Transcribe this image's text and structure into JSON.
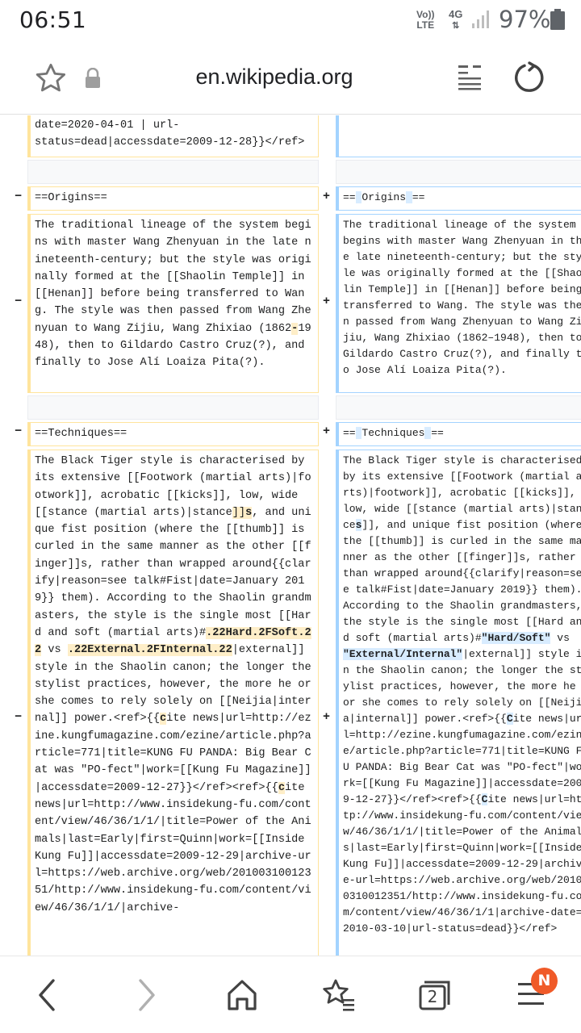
{
  "status_bar": {
    "time": "06:51",
    "volte_line1": "Vo))",
    "volte_line2": "LTE",
    "network": "4G",
    "battery": "97%"
  },
  "address_bar": {
    "url": "en.wikipedia.org"
  },
  "diff": {
    "markers": {
      "minus": "−",
      "plus": "+"
    },
    "top_left_context": "date=2020-04-01 | url-\nstatus=dead|accessdate=2009-12-28}}</ref>",
    "origins_left": "==Origins==",
    "origins_right_a": "==",
    "origins_right_b": "Origins",
    "origins_right_c": "==",
    "lineage_left_a": "The traditional lineage of the system begins with master Wang Zhenyuan in the late nineteenth-century; but the style was originally formed at the [[Shaolin Temple]] in [[Henan]] before being transferred to Wang. The style was then passed from Wang Zhenyuan to Wang Zijiu, Wang Zhixiao (1862",
    "lineage_left_dash": "-",
    "lineage_left_b": "1948), then to Gildardo Castro Cruz(?), and finally to Jose Alí Loaiza Pita(?).",
    "lineage_right": "The traditional lineage of the system begins with master Wang Zhenyuan in the late nineteenth-century; but the style was originally formed at the [[Shaolin Temple]] in [[Henan]] before being transferred to Wang. The style was then passed from Wang Zhenyuan to Wang Zijiu, Wang Zhixiao (1862–1948), then to Gildardo Castro Cruz(?), and finally to Jose Alí Loaiza Pita(?).",
    "techniques_left": "==Techniques==",
    "techniques_right_a": "==",
    "techniques_right_b": "Techniques",
    "techniques_right_c": "==",
    "tech_left_1": "The Black Tiger style is characterised by its extensive [[Footwork (martial arts)|footwork]], acrobatic [[kicks]], low, wide [[stance (martial arts)|stance",
    "tech_left_2": "]]",
    "tech_left_3": "s",
    "tech_left_4": ", and unique fist position (where the [[thumb]] is curled in the same manner as the other [[finger]]s, rather than wrapped around{{clarify|reason=see talk#Fist|date=January 2019}} them). According to the Shaolin grandmasters, the style is the single most [[Hard and soft (martial arts)#",
    "tech_left_5": ".22Hard.2FSoft.22",
    "tech_left_6": " vs ",
    "tech_left_7": ".22External.2FInternal.22",
    "tech_left_8": "|external]] style in the Shaolin canon; the longer the stylist practices, however, the more he or she comes to rely solely on [[Neijia|internal]] power.<ref>{{",
    "tech_left_9": "c",
    "tech_left_10": "ite news|url=http://ezine.kungfumagazine.com/ezine/article.php?article=771|title=KUNG FU PANDA: Big Bear Cat was \"PO-fect\"|work=[[Kung Fu Magazine]]|accessdate=2009-12-27}}</ref><ref>{{",
    "tech_left_11": "c",
    "tech_left_12": "ite news|url=http://www.insidekung-fu.com/content/view/46/36/1/1/|title=Power of the Animals|last=Early|first=Quinn|work=[[Inside Kung Fu]]|accessdate=2009-12-29|archive-url=https://web.archive.org/web/20100310012351/http://www.insidekung-fu.com/content/view/46/36/1/1/|archive-",
    "tech_right_1": "The Black Tiger style is characterised by its extensive [[Footwork (martial arts)|footwork]], acrobatic [[kicks]], low, wide [[stance (martial arts)|stance",
    "tech_right_2": "s",
    "tech_right_3": "]], and unique fist position (where the [[thumb]] is curled in the same manner as the other [[finger]]s, rather than wrapped around{{clarify|reason=see talk#Fist|date=January 2019}} them). According to the Shaolin grandmasters, the style is the single most [[Hard and soft (martial arts)#",
    "tech_right_4": "\"Hard/Soft\"",
    "tech_right_5": " vs ",
    "tech_right_6": "\"External/Internal\"",
    "tech_right_7": "|external]] style in the Shaolin canon; the longer the stylist practices, however, the more he or she comes to rely solely on [[Neijia|internal]] power.<ref>{{",
    "tech_right_8": "C",
    "tech_right_9": "ite news|url=http://ezine.kungfumagazine.com/ezine/article.php?article=771|title=KUNG FU PANDA: Big Bear Cat was \"PO-fect\"|work=[[Kung Fu Magazine]]|accessdate=2009-12-27}}</ref><ref>{{",
    "tech_right_10": "C",
    "tech_right_11": "ite news|url=http://www.insidekung-fu.com/content/view/46/36/1/1/|title=Power of the Animals|last=Early|first=Quinn|work=[[Inside Kung Fu]]|accessdate=2009-12-29|archive-url=https://web.archive.org/web/20100310012351/http://www.insidekung-fu.com/content/view/46/36/1/1|archive-date=2010-03-10|url-status=dead}}</ref>"
  },
  "bottom_bar": {
    "tabs_count": "2",
    "menu_badge": "N"
  },
  "colors": {
    "deleted_border": "#ffe49c",
    "deleted_highlight": "#feeec8",
    "added_border": "#a3d3ff",
    "added_highlight": "#d8ecff",
    "badge": "#f05a28"
  }
}
